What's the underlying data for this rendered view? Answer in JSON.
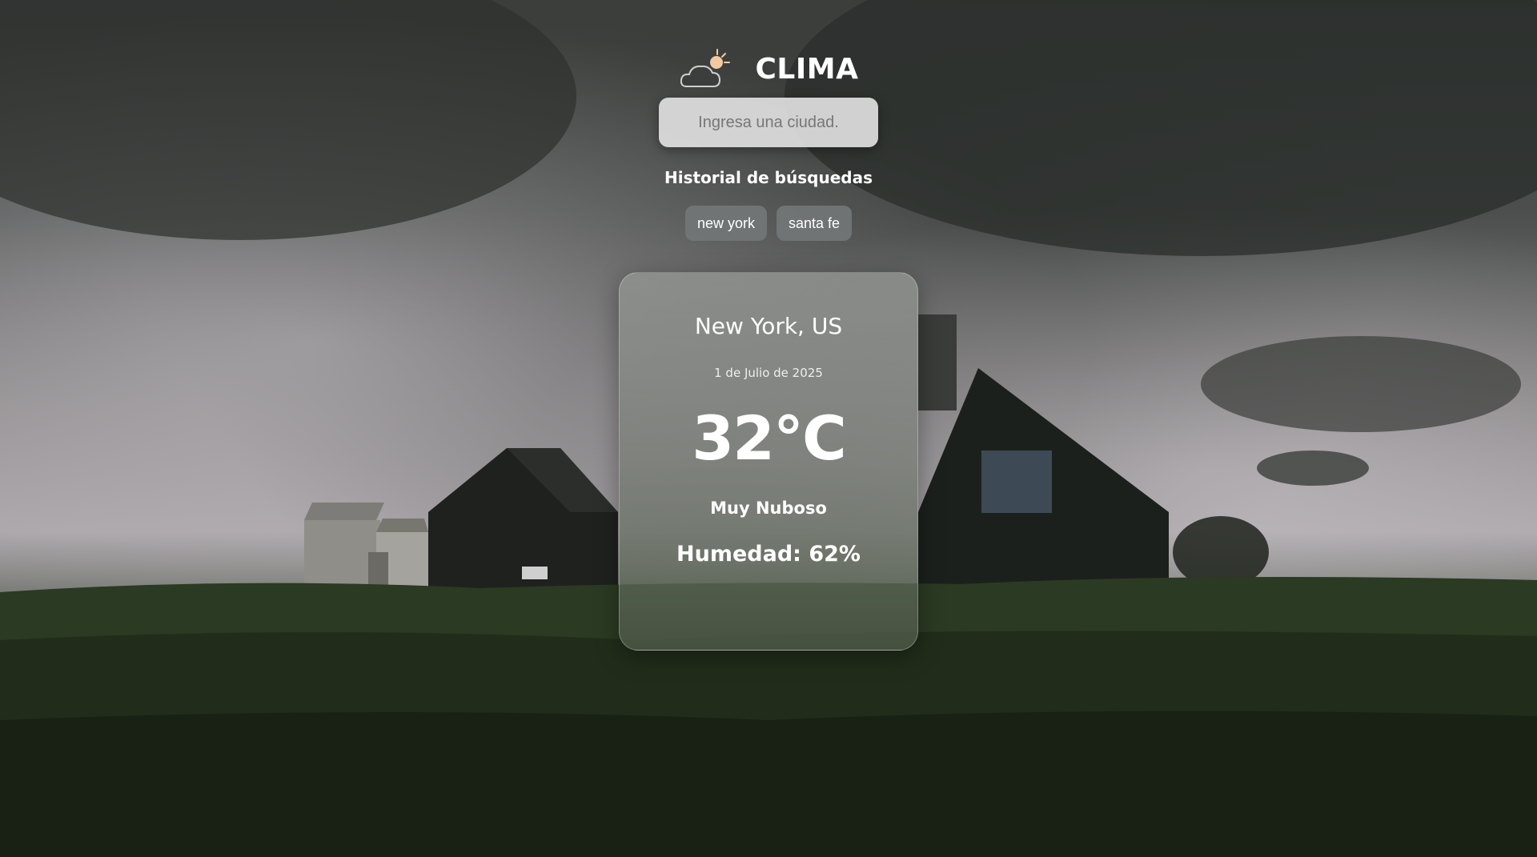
{
  "app": {
    "title": "CLIMA",
    "logo_icon": "cloud-sun-icon"
  },
  "search": {
    "placeholder": "Ingresa una ciudad.",
    "value": ""
  },
  "history": {
    "title": "Historial de búsquedas",
    "items": [
      "new york",
      "santa fe"
    ]
  },
  "weather": {
    "city": "New York, US",
    "date": "1 de Julio de 2025",
    "temperature": "32°C",
    "description": "Muy Nuboso",
    "humidity": "Humedad: 62%"
  },
  "colors": {
    "text": "#ffffff",
    "sun": "#f3c9a0",
    "chip_bg": "#737676",
    "input_bg": "#dedede"
  }
}
